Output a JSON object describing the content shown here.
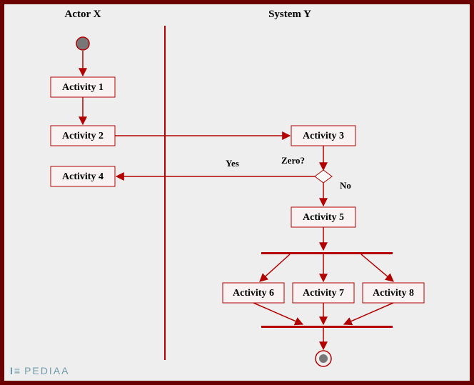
{
  "swimlanes": {
    "left": "Actor X",
    "right": "System Y"
  },
  "nodes": {
    "a1": "Activity 1",
    "a2": "Activity 2",
    "a3": "Activity 3",
    "a4": "Activity 4",
    "a5": "Activity 5",
    "a6": "Activity 6",
    "a7": "Activity 7",
    "a8": "Activity 8"
  },
  "decision": {
    "question": "Zero?",
    "yes": "Yes",
    "no": "No"
  },
  "watermark": "PEDIAA"
}
